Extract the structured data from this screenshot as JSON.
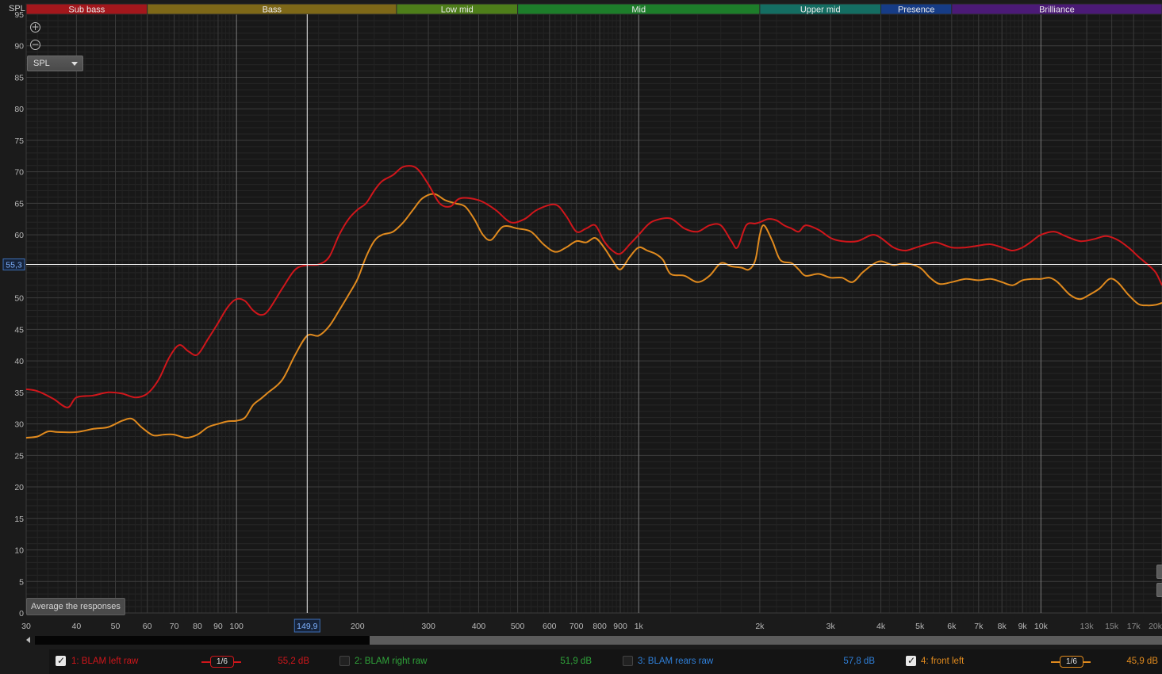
{
  "chart_data": {
    "type": "line",
    "ylabel": "SPL",
    "y_axis": {
      "min": 0,
      "max": 95,
      "ticks": [
        0,
        5,
        10,
        15,
        20,
        25,
        30,
        35,
        40,
        45,
        50,
        55,
        60,
        65,
        70,
        75,
        80,
        85,
        90,
        95
      ]
    },
    "x_axis": {
      "scale": "log",
      "min": 30,
      "max": 20000,
      "ticks": [
        {
          "v": 30,
          "label": "30"
        },
        {
          "v": 40,
          "label": "40"
        },
        {
          "v": 50,
          "label": "50"
        },
        {
          "v": 60,
          "label": "60"
        },
        {
          "v": 70,
          "label": "70"
        },
        {
          "v": 80,
          "label": "80"
        },
        {
          "v": 90,
          "label": "90"
        },
        {
          "v": 100,
          "label": "100"
        },
        {
          "v": 200,
          "label": "200"
        },
        {
          "v": 300,
          "label": "300"
        },
        {
          "v": 400,
          "label": "400"
        },
        {
          "v": 500,
          "label": "500"
        },
        {
          "v": 600,
          "label": "600"
        },
        {
          "v": 700,
          "label": "700"
        },
        {
          "v": 800,
          "label": "800"
        },
        {
          "v": 900,
          "label": "900"
        },
        {
          "v": 1000,
          "label": "1k"
        },
        {
          "v": 2000,
          "label": "2k"
        },
        {
          "v": 3000,
          "label": "3k"
        },
        {
          "v": 4000,
          "label": "4k"
        },
        {
          "v": 5000,
          "label": "5k"
        },
        {
          "v": 6000,
          "label": "6k"
        },
        {
          "v": 7000,
          "label": "7k"
        },
        {
          "v": 8000,
          "label": "8k"
        },
        {
          "v": 9000,
          "label": "9k"
        },
        {
          "v": 10000,
          "label": "10k"
        },
        {
          "v": 13000,
          "label": "13k"
        },
        {
          "v": 15000,
          "label": "15k"
        },
        {
          "v": 17000,
          "label": "17k"
        },
        {
          "v": 20000,
          "label": "20k"
        }
      ]
    },
    "bands": [
      {
        "label": "Sub bass",
        "from": 30,
        "to": 60,
        "color": "#a3171c"
      },
      {
        "label": "Bass",
        "from": 60,
        "to": 250,
        "color": "#7e6818"
      },
      {
        "label": "Low mid",
        "from": 250,
        "to": 500,
        "color": "#4e7e1a"
      },
      {
        "label": "Mid",
        "from": 500,
        "to": 2000,
        "color": "#1d7d2a"
      },
      {
        "label": "Upper mid",
        "from": 2000,
        "to": 4000,
        "color": "#146d62"
      },
      {
        "label": "Presence",
        "from": 4000,
        "to": 6000,
        "color": "#163c86"
      },
      {
        "label": "Brilliance",
        "from": 6000,
        "to": 20000,
        "color": "#4b1a76"
      }
    ],
    "cursor": {
      "x": 149.9,
      "x_label": "149,9",
      "y": 55.3,
      "y_label": "55,3"
    },
    "series": [
      {
        "name": "1: BLAM left raw",
        "color": "#d0161b",
        "points": [
          [
            30,
            35.5
          ],
          [
            32,
            35.2
          ],
          [
            35,
            34
          ],
          [
            38,
            32.6
          ],
          [
            40,
            34.2
          ],
          [
            44,
            34.5
          ],
          [
            48,
            35.0
          ],
          [
            52,
            34.8
          ],
          [
            56,
            34.2
          ],
          [
            60,
            34.8
          ],
          [
            64,
            37
          ],
          [
            68,
            40.5
          ],
          [
            72,
            42.5
          ],
          [
            76,
            41.5
          ],
          [
            80,
            41
          ],
          [
            85,
            43.5
          ],
          [
            90,
            46
          ],
          [
            95,
            48.5
          ],
          [
            100,
            49.8
          ],
          [
            105,
            49.5
          ],
          [
            110,
            48
          ],
          [
            115,
            47.3
          ],
          [
            120,
            48
          ],
          [
            130,
            51.5
          ],
          [
            140,
            54.5
          ],
          [
            150,
            55.2
          ],
          [
            160,
            55.3
          ],
          [
            170,
            56.5
          ],
          [
            180,
            60
          ],
          [
            190,
            62.5
          ],
          [
            200,
            64
          ],
          [
            210,
            65
          ],
          [
            220,
            67
          ],
          [
            230,
            68.5
          ],
          [
            245,
            69.5
          ],
          [
            260,
            70.8
          ],
          [
            280,
            70.6
          ],
          [
            300,
            68
          ],
          [
            320,
            65
          ],
          [
            340,
            64.5
          ],
          [
            360,
            65.8
          ],
          [
            400,
            65.5
          ],
          [
            440,
            64
          ],
          [
            480,
            62
          ],
          [
            520,
            62.5
          ],
          [
            560,
            64
          ],
          [
            620,
            64.8
          ],
          [
            660,
            63
          ],
          [
            700,
            60.5
          ],
          [
            740,
            61
          ],
          [
            780,
            61.5
          ],
          [
            820,
            59
          ],
          [
            860,
            57.5
          ],
          [
            900,
            57
          ],
          [
            950,
            58.5
          ],
          [
            1000,
            60
          ],
          [
            1050,
            61.5
          ],
          [
            1100,
            62.3
          ],
          [
            1200,
            62.6
          ],
          [
            1300,
            61
          ],
          [
            1400,
            60.5
          ],
          [
            1500,
            61.5
          ],
          [
            1600,
            61.5
          ],
          [
            1700,
            59
          ],
          [
            1760,
            58
          ],
          [
            1850,
            61.5
          ],
          [
            1950,
            61.8
          ],
          [
            2000,
            62
          ],
          [
            2100,
            62.5
          ],
          [
            2200,
            62.3
          ],
          [
            2300,
            61.5
          ],
          [
            2400,
            61
          ],
          [
            2500,
            60.5
          ],
          [
            2600,
            61.5
          ],
          [
            2800,
            60.8
          ],
          [
            3000,
            59.5
          ],
          [
            3200,
            59
          ],
          [
            3500,
            59
          ],
          [
            3800,
            60
          ],
          [
            4000,
            59.5
          ],
          [
            4300,
            58
          ],
          [
            4600,
            57.5
          ],
          [
            4900,
            58
          ],
          [
            5200,
            58.5
          ],
          [
            5500,
            58.8
          ],
          [
            6000,
            58
          ],
          [
            6500,
            58
          ],
          [
            7000,
            58.3
          ],
          [
            7500,
            58.5
          ],
          [
            8000,
            58
          ],
          [
            8500,
            57.5
          ],
          [
            9000,
            58
          ],
          [
            9500,
            59
          ],
          [
            10000,
            60
          ],
          [
            10800,
            60.5
          ],
          [
            11500,
            59.8
          ],
          [
            12500,
            59
          ],
          [
            13500,
            59.3
          ],
          [
            14500,
            59.8
          ],
          [
            15500,
            59.2
          ],
          [
            16500,
            58
          ],
          [
            17500,
            56.5
          ],
          [
            18500,
            55.2
          ],
          [
            19300,
            54
          ],
          [
            20000,
            52
          ]
        ]
      },
      {
        "name": "4: front left",
        "color": "#e08a1e",
        "points": [
          [
            30,
            27.8
          ],
          [
            32,
            28
          ],
          [
            34,
            28.8
          ],
          [
            36,
            28.7
          ],
          [
            40,
            28.7
          ],
          [
            44,
            29.2
          ],
          [
            48,
            29.5
          ],
          [
            52,
            30.5
          ],
          [
            55,
            30.8
          ],
          [
            58,
            29.5
          ],
          [
            62,
            28.2
          ],
          [
            66,
            28.3
          ],
          [
            70,
            28.3
          ],
          [
            75,
            27.8
          ],
          [
            80,
            28.3
          ],
          [
            85,
            29.5
          ],
          [
            90,
            30
          ],
          [
            95,
            30.4
          ],
          [
            100,
            30.5
          ],
          [
            105,
            31
          ],
          [
            110,
            33
          ],
          [
            115,
            34
          ],
          [
            120,
            35
          ],
          [
            130,
            37
          ],
          [
            140,
            41
          ],
          [
            150,
            44
          ],
          [
            160,
            44
          ],
          [
            170,
            45.5
          ],
          [
            180,
            48
          ],
          [
            190,
            50.5
          ],
          [
            200,
            53
          ],
          [
            210,
            56.5
          ],
          [
            220,
            59
          ],
          [
            230,
            60
          ],
          [
            245,
            60.5
          ],
          [
            260,
            62
          ],
          [
            275,
            64
          ],
          [
            290,
            65.8
          ],
          [
            310,
            66.5
          ],
          [
            330,
            65.5
          ],
          [
            350,
            65
          ],
          [
            370,
            64.5
          ],
          [
            390,
            62.5
          ],
          [
            410,
            60
          ],
          [
            430,
            59.2
          ],
          [
            460,
            61.3
          ],
          [
            500,
            61
          ],
          [
            540,
            60.5
          ],
          [
            580,
            58.5
          ],
          [
            620,
            57.3
          ],
          [
            660,
            58
          ],
          [
            700,
            59
          ],
          [
            740,
            58.8
          ],
          [
            780,
            59.5
          ],
          [
            820,
            58
          ],
          [
            860,
            56
          ],
          [
            900,
            54.5
          ],
          [
            950,
            56.5
          ],
          [
            1000,
            58
          ],
          [
            1050,
            57.5
          ],
          [
            1100,
            57
          ],
          [
            1150,
            56
          ],
          [
            1200,
            53.8
          ],
          [
            1300,
            53.5
          ],
          [
            1400,
            52.5
          ],
          [
            1500,
            53.5
          ],
          [
            1600,
            55.5
          ],
          [
            1700,
            55
          ],
          [
            1800,
            54.8
          ],
          [
            1880,
            54.5
          ],
          [
            1950,
            56
          ],
          [
            2000,
            60
          ],
          [
            2050,
            61.5
          ],
          [
            2150,
            59
          ],
          [
            2250,
            56
          ],
          [
            2400,
            55.5
          ],
          [
            2500,
            54.5
          ],
          [
            2600,
            53.5
          ],
          [
            2800,
            53.8
          ],
          [
            3000,
            53.2
          ],
          [
            3200,
            53.2
          ],
          [
            3400,
            52.5
          ],
          [
            3600,
            54
          ],
          [
            3800,
            55.2
          ],
          [
            4000,
            55.8
          ],
          [
            4300,
            55.2
          ],
          [
            4600,
            55.5
          ],
          [
            5000,
            54.8
          ],
          [
            5300,
            53.2
          ],
          [
            5600,
            52.2
          ],
          [
            6000,
            52.5
          ],
          [
            6500,
            53
          ],
          [
            7000,
            52.8
          ],
          [
            7500,
            53
          ],
          [
            8000,
            52.5
          ],
          [
            8500,
            52
          ],
          [
            9000,
            52.8
          ],
          [
            9500,
            53
          ],
          [
            10000,
            53
          ],
          [
            10500,
            53.2
          ],
          [
            11000,
            52.5
          ],
          [
            11800,
            50.5
          ],
          [
            12500,
            49.8
          ],
          [
            13200,
            50.5
          ],
          [
            14000,
            51.5
          ],
          [
            14800,
            53
          ],
          [
            15500,
            52.5
          ],
          [
            16500,
            50.5
          ],
          [
            17500,
            49
          ],
          [
            18500,
            48.8
          ],
          [
            19300,
            48.9
          ],
          [
            20000,
            49.2
          ]
        ]
      }
    ]
  },
  "ui": {
    "y_title": "SPL",
    "zoom_in": "+",
    "zoom_out": "−",
    "graph_select": "SPL",
    "average_button": "Average the responses"
  },
  "legend": [
    {
      "label": "1: BLAM left raw",
      "checked": true,
      "smoothing": "1/6",
      "value": "55,2 dB",
      "color": "#d0161b"
    },
    {
      "label": "2: BLAM right raw",
      "checked": false,
      "value": "51,9 dB",
      "color": "#2fa33a"
    },
    {
      "label": "3: BLAM rears raw",
      "checked": false,
      "value": "57,8 dB",
      "color": "#2f7fd8"
    },
    {
      "label": "4: front left",
      "checked": true,
      "smoothing": "1/6",
      "value": "45,9 dB",
      "color": "#e08a1e"
    }
  ]
}
